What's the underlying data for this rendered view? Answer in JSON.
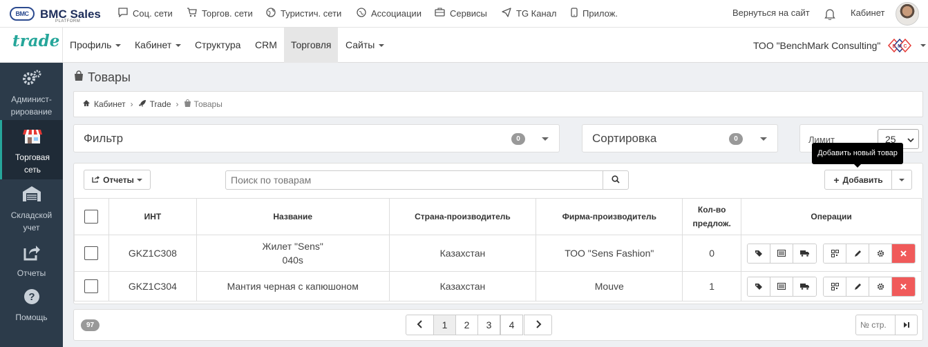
{
  "topbar": {
    "logo_badge": "BMC",
    "logo_text": "BMC Sales",
    "logo_sub": "PLATFORM",
    "links": [
      {
        "icon": "chat-icon",
        "label": "Соц. сети"
      },
      {
        "icon": "cart-icon",
        "label": "Торгов. сети"
      },
      {
        "icon": "globe-icon",
        "label": "Туристич. сети"
      },
      {
        "icon": "association-icon",
        "label": "Ассоциации"
      },
      {
        "icon": "box-icon",
        "label": "Сервисы"
      },
      {
        "icon": "send-icon",
        "label": "TG Канал"
      },
      {
        "icon": "phone-icon",
        "label": "Прилож."
      }
    ],
    "back_to_site": "Вернуться на сайт",
    "cabinet": "Кабинет"
  },
  "navbar": {
    "brand": "trade",
    "items": [
      "Профиль",
      "Кабинет",
      "Структура",
      "CRM",
      "Торговля",
      "Сайты"
    ],
    "active": "Торговля",
    "company": "ТОО \"BenchMark Consulting\"",
    "company_logo": {
      "letters": [
        "B",
        "M",
        "C"
      ],
      "colors": [
        "#e53935",
        "#1e3a8a",
        "#e53935"
      ]
    }
  },
  "sidebar": {
    "items": [
      {
        "icon": "gears-icon",
        "label": "Админист-\nрирование"
      },
      {
        "icon": "store-icon",
        "label": "Торговая\nсеть"
      },
      {
        "icon": "warehouse-icon",
        "label": "Складской\nучет"
      },
      {
        "icon": "share-icon",
        "label": "Отчеты"
      },
      {
        "icon": "help-icon",
        "label": "Помощь"
      }
    ]
  },
  "page": {
    "title": "Товары",
    "breadcrumb": [
      "Кабинет",
      "Trade",
      "Товары"
    ]
  },
  "filter": {
    "title": "Фильтр",
    "count": "0"
  },
  "sort": {
    "title": "Сортировка",
    "count": "0"
  },
  "limit": {
    "label": "Лимит",
    "value": "25"
  },
  "toolbar": {
    "reports": "Отчеты",
    "search_placeholder": "Поиск по товарам",
    "add": "Добавить",
    "tooltip": "Добавить новый товар"
  },
  "table": {
    "headers": [
      "ИНТ",
      "Название",
      "Страна-производитель",
      "Фирма-производитель",
      "Кол-во\nпредлож.",
      "Операции"
    ],
    "rows": [
      {
        "int": "GKZ1C308",
        "name": "Жилет \"Sens\"\n040s",
        "country": "Казахстан",
        "firm": "ТОО \"Sens Fashion\"",
        "offers": "0"
      },
      {
        "int": "GKZ1C304",
        "name": "Мантия черная с капюшоном",
        "country": "Казахстан",
        "firm": "Mouve",
        "offers": "1"
      }
    ]
  },
  "pagination": {
    "total": "97",
    "pages": [
      "1",
      "2",
      "3",
      "4"
    ],
    "current": "1",
    "page_input_placeholder": "№ стр."
  }
}
